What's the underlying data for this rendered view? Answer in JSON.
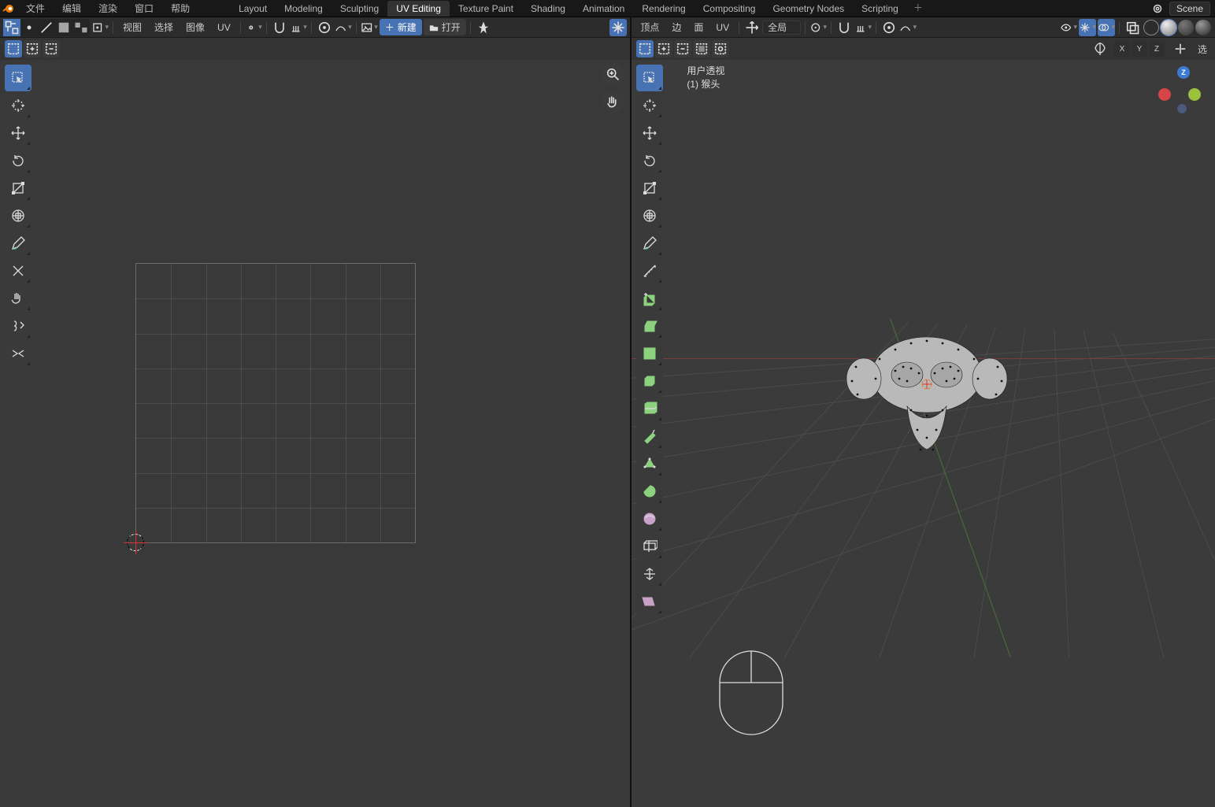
{
  "top_menu": {
    "file": "文件",
    "edit": "编辑",
    "render": "渲染",
    "window": "窗口",
    "help": "帮助"
  },
  "workspaces": [
    "Layout",
    "Modeling",
    "Sculpting",
    "UV Editing",
    "Texture Paint",
    "Shading",
    "Animation",
    "Rendering",
    "Compositing",
    "Geometry Nodes",
    "Scripting"
  ],
  "active_workspace": 3,
  "scene_name": "Scene",
  "uv_header": {
    "menu_view": "视图",
    "menu_select": "选择",
    "menu_image": "图像",
    "menu_uv": "UV",
    "btn_new": "新建",
    "btn_open": "打开"
  },
  "v3d_header": {
    "menu_vertex": "顶点",
    "menu_edge": "边",
    "menu_face": "面",
    "menu_uv": "UV",
    "orientation": "全局",
    "select_label": "选"
  },
  "overlay": {
    "line1": "用户透视",
    "line2": "(1) 猴头"
  },
  "axis_buttons": [
    "X",
    "Y",
    "Z"
  ],
  "tools_uv": [
    {
      "id": "select-box",
      "active": true
    },
    {
      "id": "cursor"
    },
    {
      "id": "move"
    },
    {
      "id": "rotate"
    },
    {
      "id": "scale"
    },
    {
      "id": "transform"
    },
    {
      "id": "annotate"
    },
    {
      "id": "rip"
    },
    {
      "id": "grab"
    },
    {
      "id": "relax"
    },
    {
      "id": "pinch"
    }
  ],
  "tools_3d": [
    {
      "id": "select-box",
      "active": true
    },
    {
      "id": "cursor"
    },
    {
      "id": "move"
    },
    {
      "id": "rotate"
    },
    {
      "id": "scale"
    },
    {
      "id": "transform"
    },
    {
      "id": "annotate"
    },
    {
      "id": "measure"
    },
    {
      "id": "add-cube",
      "tint": "green"
    },
    {
      "id": "extrude-region",
      "tint": "green"
    },
    {
      "id": "inset",
      "tint": "green"
    },
    {
      "id": "bevel",
      "tint": "green"
    },
    {
      "id": "loop-cut",
      "tint": "green"
    },
    {
      "id": "knife",
      "tint": "green"
    },
    {
      "id": "poly-build",
      "tint": "green"
    },
    {
      "id": "spin",
      "tint": "green"
    },
    {
      "id": "smooth",
      "tint": "purple"
    },
    {
      "id": "edge-slide"
    },
    {
      "id": "shrink-fatten"
    },
    {
      "id": "shear",
      "tint": "purple"
    }
  ]
}
